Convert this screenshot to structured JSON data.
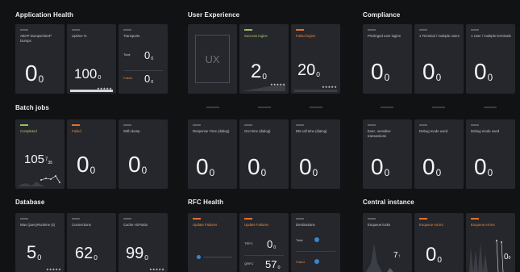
{
  "sections": {
    "app_health": "Application Health",
    "user_experience": "User Experience",
    "compliance": "Compliance",
    "batch_jobs": "Batch jobs",
    "database": "Database",
    "rfc_health": "RFC Health",
    "central_instance": "Central instance"
  },
  "app_health": {
    "abap_dumps": {
      "label": "ABAP Dumps/ABAP Dumps",
      "value": "0",
      "suffix": "0"
    },
    "uptime": {
      "label": "Uptime %",
      "value": "100",
      "suffix": "0",
      "stars": "★★★★★",
      "progress": 1.0
    },
    "transports": {
      "label": "Transports",
      "total_label": "Total",
      "total_value": "0",
      "total_suffix": "0",
      "failed_label": "Failed",
      "failed_value": "0",
      "failed_suffix": "0"
    }
  },
  "user_experience": {
    "ux_placeholder": "UX",
    "success_logins": {
      "label": "Success logins",
      "value": "2",
      "suffix": "0",
      "stars": "★★★★★"
    },
    "failed_logins": {
      "label": "Failed logins",
      "value": "20",
      "suffix": "0",
      "stars": "★★★★★"
    },
    "response_time": {
      "label": "Response Time (dialog)",
      "value": "0",
      "suffix": "0"
    },
    "gui_time": {
      "label": "GUI time (dialog)",
      "value": "0",
      "suffix": "0"
    },
    "db_call_time": {
      "label": "DB call time (dialog)",
      "value": "0",
      "suffix": "0"
    }
  },
  "compliance": {
    "privileged": {
      "label": "Privileged user logins",
      "value": "0",
      "suffix": "0"
    },
    "one_terminal": {
      "label": "1 Terminal / multiple users",
      "value": "0",
      "suffix": "0"
    },
    "one_user": {
      "label": "1 User / multiple terminals",
      "value": "0",
      "suffix": "0"
    },
    "exec_sensitive": {
      "label": "Exec. sensitive transactions",
      "value": "0",
      "suffix": "0"
    },
    "debug_used_1": {
      "label": "Debug mode used",
      "value": "0",
      "suffix": "0"
    },
    "debug_used_2": {
      "label": "Debug mode used",
      "value": "0",
      "suffix": "0"
    }
  },
  "batch_jobs": {
    "completed": {
      "label": "Completed",
      "value": "105",
      "suffix": "7",
      "suffix2": "35"
    },
    "failed": {
      "label": "Failed",
      "value": "0",
      "suffix": "0"
    },
    "with_dump": {
      "label": "With dump",
      "value": "0",
      "suffix": "0"
    }
  },
  "database": {
    "max_query": {
      "label": "Max QueryRuntime (s)",
      "value": "5",
      "suffix": "0",
      "stars": "★★★★★"
    },
    "connections": {
      "label": "Connections",
      "value": "62",
      "suffix": "0"
    },
    "cache_hit": {
      "label": "Cache Hit Ratio",
      "value": "99",
      "suffix": "0",
      "stars": "★★★★★"
    }
  },
  "rfc_health": {
    "update_failures_1": {
      "label": "Update Failures"
    },
    "update_failures_2": {
      "label": "Update Failures",
      "trfc_label": "TRFC",
      "trfc_value": "0",
      "trfc_suffix": "0",
      "qrfc_label": "QRFC",
      "qrfc_value": "57",
      "qrfc_suffix": "0"
    },
    "destinations": {
      "label": "Destinations",
      "total_label": "Total",
      "failed_label": "Failed"
    }
  },
  "central_instance": {
    "enqueue_locks": {
      "label": "Enqueue locks",
      "value": "7",
      "suffix": "↑"
    },
    "enqueue_errors_1": {
      "label": "Enqueue errors",
      "value": "0",
      "suffix": "0"
    },
    "enqueue_errors_2": {
      "label": "Enqueue errors",
      "value": "0",
      "suffix": "0"
    }
  },
  "colors": {
    "accent_green": "#9bc15a",
    "accent_orange": "#e0702e",
    "dot_blue": "#3c84c9",
    "tile_bg": "#25272c"
  }
}
